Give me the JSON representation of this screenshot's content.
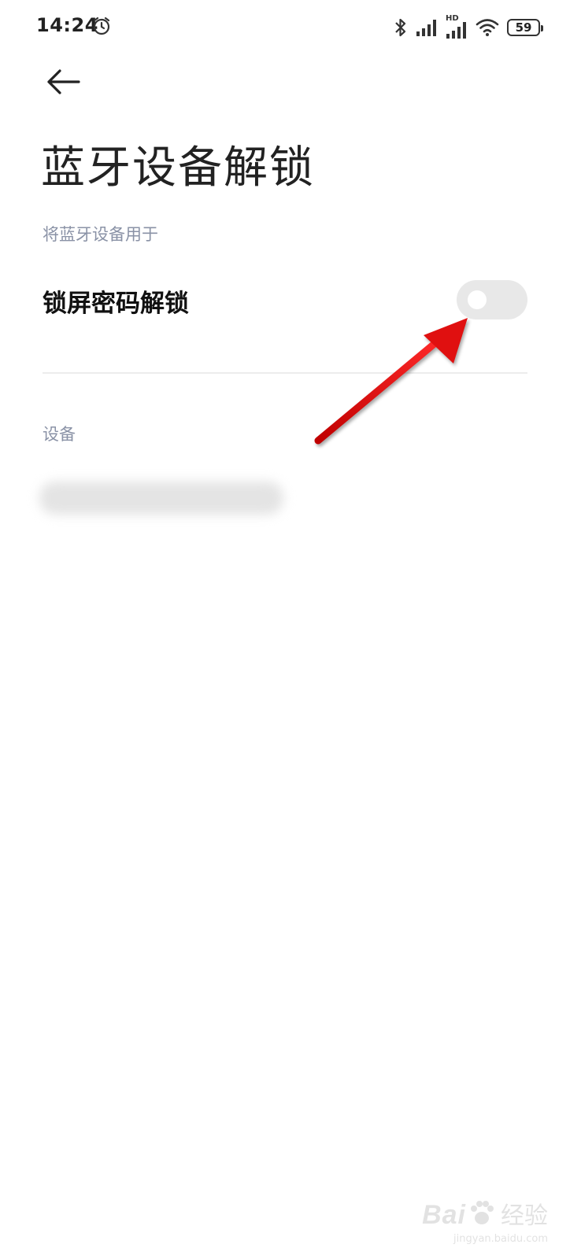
{
  "status_bar": {
    "time": "14:24",
    "battery_level": "59",
    "network_label": "HD",
    "icons": [
      "alarm-icon",
      "bluetooth-icon",
      "signal-icon",
      "signal-hd-icon",
      "wifi-icon",
      "battery-icon"
    ]
  },
  "header": {
    "back_icon": "arrow-left-icon",
    "title": "蓝牙设备解锁"
  },
  "section_use": {
    "header": "将蓝牙设备用于",
    "setting": {
      "label": "锁屏密码解锁",
      "toggle_state": "off"
    }
  },
  "section_devices": {
    "header": "设备"
  },
  "annotation": {
    "arrow_color": "#e01010"
  },
  "watermark": {
    "logo": "Bai",
    "brand": "经验",
    "url": "jingyan.baidu.com"
  },
  "colors": {
    "section_header": "#8a92a6",
    "toggle_off_track": "#e8e8e8",
    "text_primary": "#111111"
  }
}
